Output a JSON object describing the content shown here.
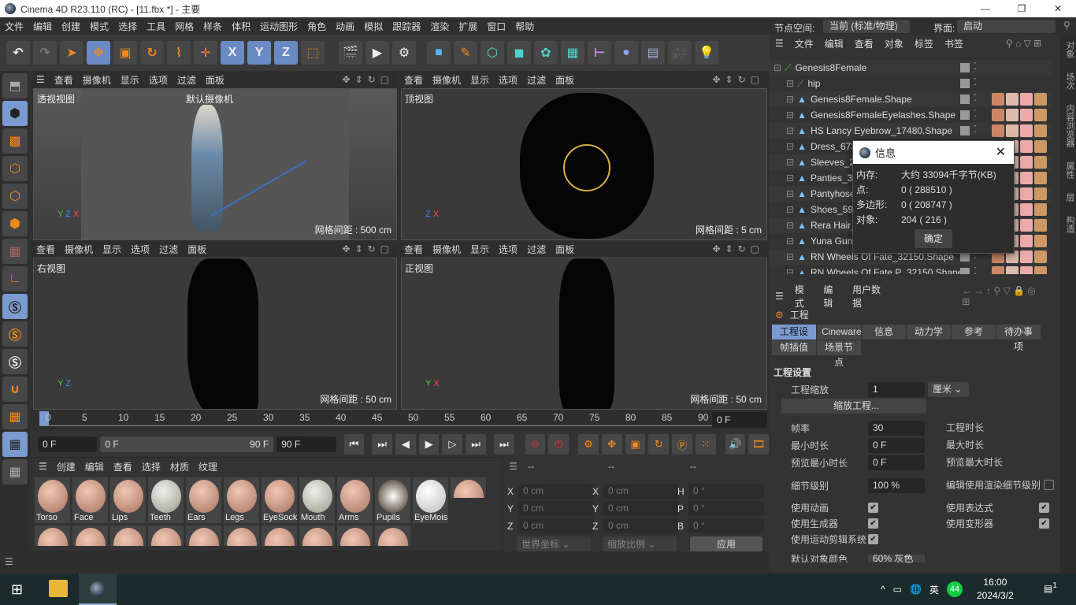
{
  "window": {
    "title": "Cinema 4D R23.110 (RC) - [11.fbx *] - 主要",
    "min": "—",
    "max": "❐",
    "close": "✕"
  },
  "menu": [
    "文件",
    "编辑",
    "创建",
    "模式",
    "选择",
    "工具",
    "网格",
    "样条",
    "体积",
    "运动图形",
    "角色",
    "动画",
    "模拟",
    "跟踪器",
    "渲染",
    "扩展",
    "窗口",
    "帮助"
  ],
  "node_space": {
    "label": "节点空间:",
    "value": "当前 (标准/物理)"
  },
  "layout": {
    "label": "界面:",
    "value": "启动"
  },
  "toolbar_icons": [
    "undo-icon",
    "redo-icon",
    "select-icon",
    "move-icon",
    "scale-icon",
    "rotate-icon",
    "recent-tool-icon",
    "world-axis-icon",
    "x-axis-lock",
    "y-axis-lock",
    "z-axis-lock",
    "coordinate-system-icon",
    "render-view-icon",
    "render-picture-icon",
    "render-settings-icon",
    "cube-icon",
    "pen-icon",
    "subdivision-icon",
    "extrude-icon",
    "cloner-icon",
    "array-icon",
    "bend-icon",
    "sphere-deformer-icon",
    "floor-icon",
    "camera-icon",
    "light-icon"
  ],
  "toolbar_axis": [
    "X",
    "Y",
    "Z"
  ],
  "viewport_menu": [
    "查看",
    "摄像机",
    "显示",
    "选项",
    "过滤",
    "面板"
  ],
  "viewports": [
    {
      "label": "透视视图",
      "camera": "默认摄像机",
      "grid": "网格间距 : 500 cm",
      "axes": [
        "Y",
        "Z",
        "X"
      ]
    },
    {
      "label": "顶视图",
      "grid": "网格间距 : 5 cm",
      "axes": [
        "Z",
        "X"
      ]
    },
    {
      "label": "右视图",
      "grid": "网格间距 : 50 cm",
      "axes": [
        "Y",
        "Z"
      ]
    },
    {
      "label": "正视图",
      "grid": "网格间距 : 50 cm",
      "axes": [
        "Y",
        "X"
      ]
    }
  ],
  "timeline": {
    "ticks": [
      "0",
      "5",
      "10",
      "15",
      "20",
      "25",
      "30",
      "35",
      "40",
      "45",
      "50",
      "55",
      "60",
      "65",
      "70",
      "75",
      "80",
      "85",
      "90"
    ],
    "current_frame": "0 F",
    "range_start": "0 F",
    "range_end": "90 F",
    "end_frame": "90 F",
    "end_field": "0 F"
  },
  "materials": {
    "menu": [
      "创建",
      "编辑",
      "查看",
      "选择",
      "材质",
      "纹理"
    ],
    "items": [
      "Torso",
      "Face",
      "Lips",
      "Teeth",
      "Ears",
      "Legs",
      "EyeSock",
      "Mouth",
      "Arms",
      "Pupils",
      "EyeMois"
    ]
  },
  "coordinates": {
    "headers": [
      "--",
      "--",
      "--"
    ],
    "pos": [
      {
        "axis": "X",
        "value": "0 cm"
      },
      {
        "axis": "Y",
        "value": "0 cm"
      },
      {
        "axis": "Z",
        "value": "0 cm"
      }
    ],
    "size": [
      {
        "axis": "X",
        "value": "0 cm"
      },
      {
        "axis": "Y",
        "value": "0 cm"
      },
      {
        "axis": "Z",
        "value": "0 cm"
      }
    ],
    "rot": [
      {
        "axis": "H",
        "value": "0 °"
      },
      {
        "axis": "P",
        "value": "0 °"
      },
      {
        "axis": "B",
        "value": "0 °"
      }
    ],
    "mode": "世界坐标",
    "scale_mode": "缩放比例",
    "apply": "应用"
  },
  "object_manager": {
    "menu": [
      "文件",
      "编辑",
      "查看",
      "对象",
      "标签",
      "书签"
    ],
    "objects": [
      "Genesis8Female",
      "hip",
      "Genesis8Female.Shape",
      "Genesis8FemaleEyelashes.Shape",
      "HS Lancy Eyebrow_17480.Shape",
      "Dress_6734",
      "Sleeves_21",
      "Panties_330",
      "Pantyhose_",
      "Shoes_598",
      "Rera Hair_1",
      "Yuna Gunn",
      "RN Wheels Of Fate_32150.Shape",
      "RN Wheels Of Fate P_32150.Shape"
    ]
  },
  "info_dialog": {
    "title": "信息",
    "rows": [
      {
        "k": "内存:",
        "v": "大约 33094千字节(KB)"
      },
      {
        "k": "点:",
        "v": "0 ( 288510 )"
      },
      {
        "k": "多边形:",
        "v": "0 ( 208747 )"
      },
      {
        "k": "对象:",
        "v": "204 ( 216 )"
      }
    ],
    "ok": "确定"
  },
  "attributes": {
    "menu": [
      "模式",
      "编辑",
      "用户数据"
    ],
    "object": "工程",
    "tabs": [
      "工程设置",
      "Cineware",
      "信息",
      "动力学",
      "参考",
      "待办事项",
      "帧插值",
      "场景节点"
    ],
    "section": "工程设置",
    "scale_label": "工程缩放",
    "scale_value": "1",
    "scale_unit": "厘米",
    "scale_button": "缩放工程...",
    "fps_label": "帧率",
    "fps": "30",
    "min_label": "最小时长",
    "min": "0 F",
    "pmin_label": "预览最小时长",
    "pmin": "0 F",
    "dur_label": "工程时长",
    "max_label": "最大时长",
    "pmax_label": "预览最大时长",
    "lod_label": "细节级别",
    "lod": "100 %",
    "render_lod_label": "编辑使用渲染细节级别",
    "checks": [
      "使用动画",
      "使用生成器",
      "使用运动剪辑系统",
      "使用表达式",
      "使用变形器"
    ],
    "color_label": "默认对象颜色",
    "color_value": "60% 灰色"
  },
  "right_tabs": [
    "对象",
    "场次",
    "内容浏览器",
    "属性",
    "层",
    "构造"
  ],
  "taskbar": {
    "time": "16:00",
    "date": "2024/3/2",
    "ime": "英",
    "badge": "44",
    "notifications": "1"
  },
  "colors": {
    "accent": "#7b9ad0",
    "orange": "#f08a1c",
    "bg": "#333333"
  }
}
